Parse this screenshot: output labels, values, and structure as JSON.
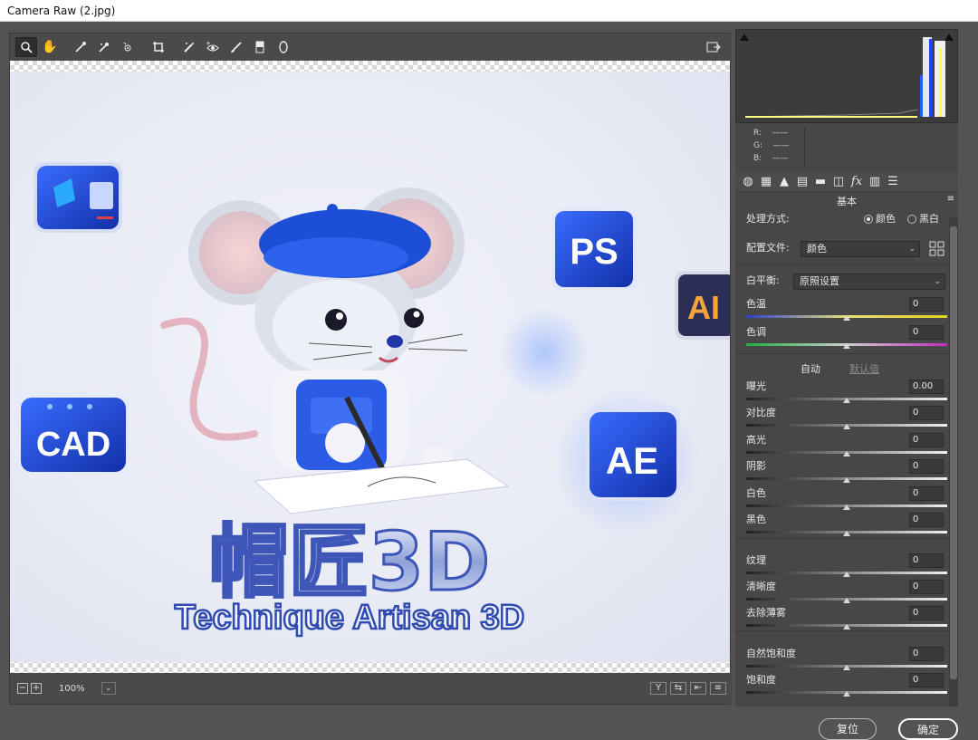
{
  "window": {
    "title": "Camera Raw (2.jpg)"
  },
  "toolbar": {
    "tools": [
      "zoom-tool",
      "hand-tool",
      "white-balance-tool",
      "color-sampler-tool",
      "targeted-adjustment-tool",
      "crop-tool",
      "spot-removal-tool",
      "red-eye-tool",
      "adjustment-brush-tool",
      "graduated-filter-tool",
      "radial-filter-tool"
    ],
    "fullscreen": "fullscreen-icon"
  },
  "image": {
    "big_title": "帽匠3D",
    "subtitle": "Technique Artisan 3D",
    "badges": [
      "PS",
      "AI",
      "CAD",
      "AE"
    ]
  },
  "statusbar": {
    "zoom": "100%",
    "y_label": "Y"
  },
  "histogram": {
    "r_label": "R:",
    "g_label": "G:",
    "b_label": "B:",
    "r_value": "——",
    "g_value": "——",
    "b_value": "——"
  },
  "panel": {
    "title": "基本",
    "treatment_label": "处理方式:",
    "treatment_color": "颜色",
    "treatment_bw": "黑白",
    "profile_label": "配置文件:",
    "profile_value": "颜色",
    "wb_label": "白平衡:",
    "wb_value": "原照设置",
    "auto_label": "自动",
    "default_label": "默认值",
    "sliders": [
      {
        "label": "色温",
        "value": "0",
        "level": 0.5
      },
      {
        "label": "色调",
        "value": "0",
        "level": 0.5
      },
      {
        "label": "曝光",
        "value": "0.00",
        "level": 0.5
      },
      {
        "label": "对比度",
        "value": "0",
        "level": 0.5
      },
      {
        "label": "高光",
        "value": "0",
        "level": 0.5
      },
      {
        "label": "阴影",
        "value": "0",
        "level": 0.5
      },
      {
        "label": "白色",
        "value": "0",
        "level": 0.5
      },
      {
        "label": "黑色",
        "value": "0",
        "level": 0.5
      },
      {
        "label": "纹理",
        "value": "0",
        "level": 0.5
      },
      {
        "label": "清晰度",
        "value": "0",
        "level": 0.5
      },
      {
        "label": "去除薄雾",
        "value": "0",
        "level": 0.5
      },
      {
        "label": "自然饱和度",
        "value": "0",
        "level": 0.5
      },
      {
        "label": "饱和度",
        "value": "0",
        "level": 0.5
      }
    ]
  },
  "footer": {
    "reset": "复位",
    "ok": "确定"
  }
}
